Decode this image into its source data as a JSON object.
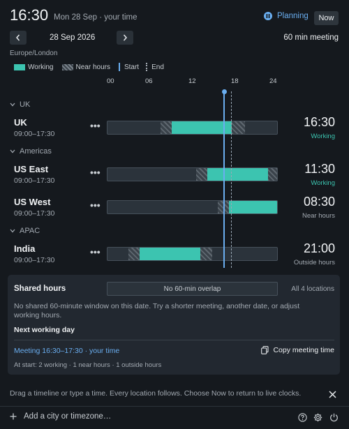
{
  "header": {
    "clock": "16:30",
    "date_line": "Mon 28 Sep · your time",
    "planning_label": "Planning",
    "now_label": "Now"
  },
  "nav": {
    "date": "28 Sep 2026",
    "meeting_length": "60 min meeting"
  },
  "timezone_label": "Europe/London",
  "legend": {
    "working": "Working",
    "near": "Near hours",
    "start": "Start",
    "end": "End"
  },
  "axis_ticks": [
    "00",
    "06",
    "12",
    "18",
    "24"
  ],
  "groups": [
    {
      "name": "UK",
      "locations": [
        {
          "name": "UK",
          "hours": "09:00–17:30",
          "time": "16:30",
          "status": "Working",
          "status_color": "#3cc4b0"
        }
      ]
    },
    {
      "name": "Americas",
      "locations": [
        {
          "name": "US East",
          "hours": "09:00–17:30",
          "time": "11:30",
          "status": "Working",
          "status_color": "#3cc4b0"
        },
        {
          "name": "US West",
          "hours": "09:00–17:30",
          "time": "08:30",
          "status": "Near hours",
          "status_color": "#a3aab2"
        }
      ]
    },
    {
      "name": "APAC",
      "locations": [
        {
          "name": "India",
          "hours": "09:00–17:30",
          "time": "21:00",
          "status": "Outside hours",
          "status_color": "#a3aab2"
        }
      ]
    }
  ],
  "shared": {
    "title": "Shared hours",
    "overlap_label": "No 60-min overlap",
    "locations_label": "All 4 locations",
    "message": "No shared 60-minute window on this date. Try a shorter meeting, another date, or adjust working hours.",
    "next_working_day": "Next working day",
    "meeting_line": "Meeting 16:30–17:30 · your time",
    "copy_label": "Copy meeting time",
    "at_start": "At start: 2 working · 1 near hours · 1 outside hours"
  },
  "hint": "Drag a timeline or type a time. Every location follows. Choose Now to return to live clocks.",
  "footer": {
    "add_placeholder": "Add a city or timezone…"
  },
  "colors": {
    "accent": "#3cc4b0",
    "link": "#6aaef0",
    "background": "#15191e"
  }
}
